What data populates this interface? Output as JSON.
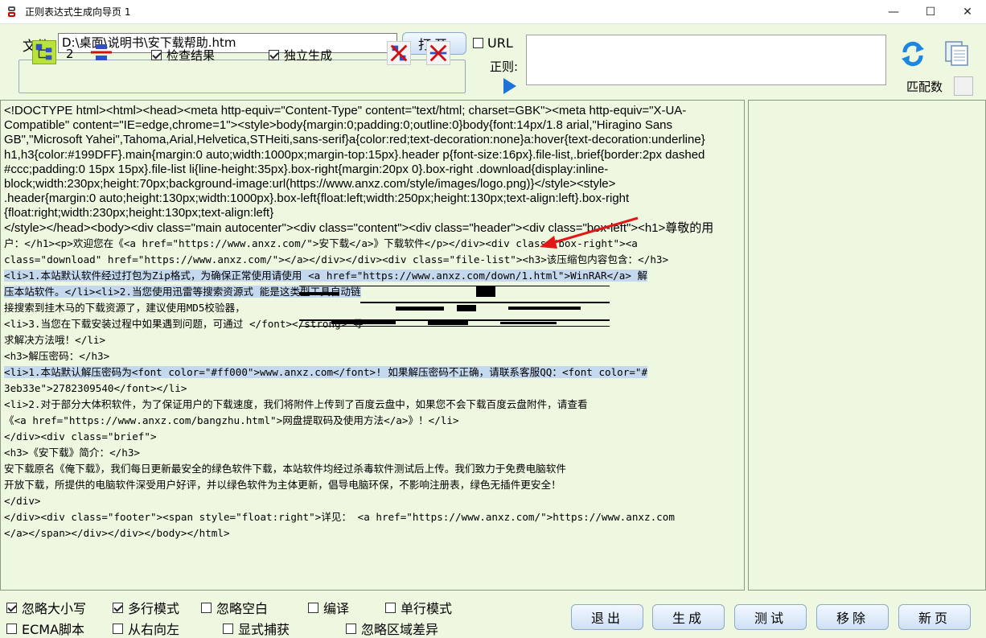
{
  "window": {
    "title": "正则表达式生成向导页 1",
    "minimize": "—",
    "maximize": "☐",
    "close": "✕"
  },
  "file": {
    "label": "文件",
    "path": "D:\\桌面\\说明书\\安下载帮助.htm",
    "open_button": "打开"
  },
  "url_option": {
    "label": "URL",
    "checked": false
  },
  "regex": {
    "label": "正则:",
    "value": ""
  },
  "match": {
    "label": "匹配数",
    "value": ""
  },
  "tools": {
    "count": "2",
    "check_result": "检查结果",
    "standalone": "独立生成"
  },
  "code_lines": [
    {
      "t": "<!DOCTYPE html><html><head><meta http-equiv=\"Content-Type\" content=\"text/html; charset=GBK\"><meta http-equiv=\"X-UA-",
      "mono": false
    },
    {
      "t": "Compatible\" content=\"IE=edge,chrome=1\"><style>body{margin:0;padding:0;outline:0}body{font:14px/1.8 arial,\"Hiragino Sans",
      "mono": false
    },
    {
      "t": "GB\",\"Microsoft Yahei\",Tahoma,Arial,Helvetica,STHeiti,sans-serif}a{color:red;text-decoration:none}a:hover{text-decoration:underline}",
      "mono": false
    },
    {
      "t": "h1,h3{color:#199DFF}.main{margin:0 auto;width:1000px;margin-top:15px}.header p{font-size:16px}.file-list,.brief{border:2px dashed",
      "mono": false
    },
    {
      "t": "#ccc;padding:0 15px 15px}.file-list li{line-height:35px}.box-right{margin:20px 0}.box-right .download{display:inline-",
      "mono": false
    },
    {
      "t": "block;width:230px;height:70px;background-image:url(https://www.anxz.com/style/images/logo.png)}</style><style>",
      "mono": false
    },
    {
      "t": ".header{margin:0 auto;height:130px;width:1000px}.box-left{float:left;width:250px;height:130px;text-align:left}.box-right",
      "mono": false
    },
    {
      "t": "{float:right;width:230px;height:130px;text-align:left}",
      "mono": false
    },
    {
      "t": "</style></head><body><div class=\"main autocenter\"><div class=\"content\"><div class=\"header\"><div class=\"box-left\"><h1>尊敬的用",
      "mono": false
    },
    {
      "t": "户：</h1><p>欢迎您在《<a href=\"https://www.anxz.com/\">安下载</a>》下载软件</p></div><div class=\"box-right\"><a",
      "mono": true
    },
    {
      "t": "class=\"download\" href=\"https://www.anxz.com/\"></a></div></div><div class=\"file-list\"><h3>该压缩包内容包含：</h3>",
      "mono": true
    },
    {
      "t": "<li>1.本站默认软件经过打包为Zip格式，为确保正常使用请使用 <a href=\"https://www.anxz.com/down/1.html\">WinRAR</a> 解",
      "mono": true,
      "hl": true
    },
    {
      "t": "压本站软件。</li><li>2.当您使用迅雷等搜索资源式                                    能是这类型工具自动链",
      "mono": true,
      "hl2": true
    },
    {
      "t": "接搜索到挂木马的下载资源了，建议使用MD5校验器，",
      "mono": true
    },
    {
      "t": "<li>3.当您在下载安装过程中如果遇到问题，可通过                                    </font></strong> 寻",
      "mono": true
    },
    {
      "t": "求解决方法哦！</li>",
      "mono": true
    },
    {
      "t": "<h3>解压密码：</h3>",
      "mono": true
    },
    {
      "t": "<li>1.本站默认解压密码为<font color=\"#ff000\">www.anxz.com</font>! 如果解压密码不正确，请联系客服QQ：<font color=\"#",
      "mono": true,
      "hl3": true
    },
    {
      "t": "3eb33e\">2782309540</font></li>",
      "mono": true
    },
    {
      "t": "<li>2.对于部分大体积软件，为了保证用户的下载速度，我们将附件上传到了百度云盘中，如果您不会下载百度云盘附件，请查看",
      "mono": true
    },
    {
      "t": "《<a href=\"https://www.anxz.com/bangzhu.html\">网盘提取码及使用方法</a>》！</li>",
      "mono": true
    },
    {
      "t": "</div><div class=\"brief\">",
      "mono": true
    },
    {
      "t": "  <h3>《安下载》简介：</h3>",
      "mono": true
    },
    {
      "t": "  安下载原名《俺下载》，我们每日更新最安全的绿色软件下载，本站软件均经过杀毒软件测试后上传。我们致力于免费电脑软件",
      "mono": true
    },
    {
      "t": "开放下载，所提供的电脑软件深受用户好评，并以绿色软件为主体更新，倡导电脑环保，不影响注册表，绿色无插件更安全！",
      "mono": true
    },
    {
      "t": "</div>",
      "mono": true
    },
    {
      "t": "</div><div class=\"footer\"><span style=\"float:right\">详见： <a href=\"https://www.anxz.com/\">https://www.anxz.com",
      "mono": true
    },
    {
      "t": "</a></span></div></div></body></html>",
      "mono": true
    }
  ],
  "options": {
    "ignore_case": "忽略大小写",
    "multiline": "多行模式",
    "ignore_whitespace": "忽略空白",
    "compile": "编译",
    "singleline": "单行模式",
    "ecma": "ECMA脚本",
    "right_to_left": "从右向左",
    "explicit_capture": "显式捕获",
    "ignore_culture": "忽略区域差异"
  },
  "buttons": {
    "exit": "退出",
    "generate": "生成",
    "test": "测试",
    "remove": "移除",
    "new_page": "新页"
  }
}
